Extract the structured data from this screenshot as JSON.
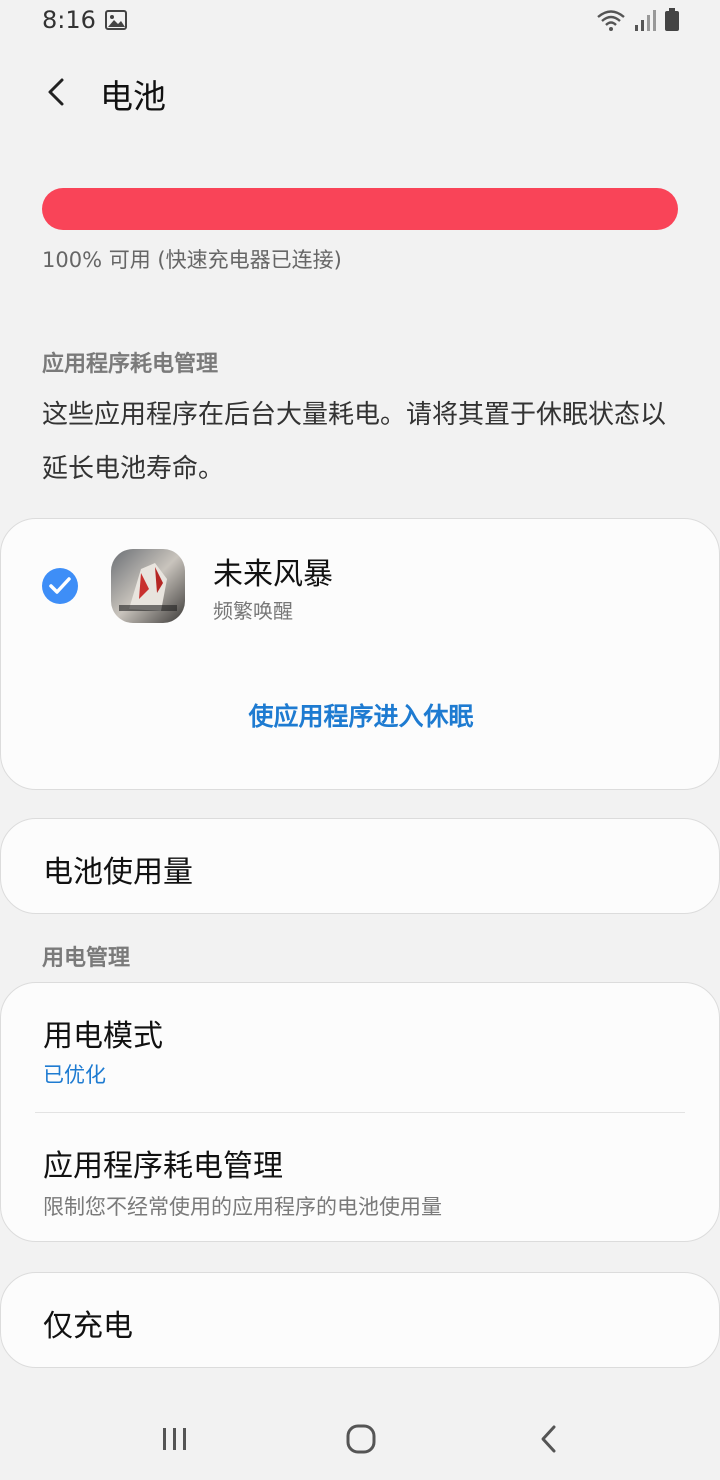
{
  "status_bar": {
    "time": "8:16",
    "icons": [
      "gallery-icon",
      "wifi-icon",
      "signal-icon",
      "battery-icon"
    ]
  },
  "app_bar": {
    "title": "电池",
    "back_icon": "back-arrow-icon"
  },
  "battery": {
    "status_text": "100% 可用 (快速充电器已连接)",
    "level_fraction": 1.0,
    "bar_color": "#f94458"
  },
  "app_power_section": {
    "header": "应用程序耗电管理",
    "description": "这些应用程序在后台大量耗电。请将其置于休眠状态以延长电池寿命。",
    "app": {
      "name": "未来风暴",
      "subtitle": "频繁唤醒",
      "checked": true
    },
    "action_label": "使应用程序进入休眠"
  },
  "battery_usage": {
    "label": "电池使用量"
  },
  "power_management": {
    "header": "用电管理",
    "items": [
      {
        "title": "用电模式",
        "subtitle": "已优化"
      },
      {
        "title": "应用程序耗电管理",
        "subtitle": "限制您不经常使用的应用程序的电池使用量"
      }
    ]
  },
  "charge_only": {
    "label": "仅充电"
  },
  "colors": {
    "accent_blue": "#1e7bd1",
    "check_blue": "#3e8ef7"
  },
  "nav_bar": {
    "icons": [
      "recents-icon",
      "home-icon",
      "back-icon"
    ]
  }
}
